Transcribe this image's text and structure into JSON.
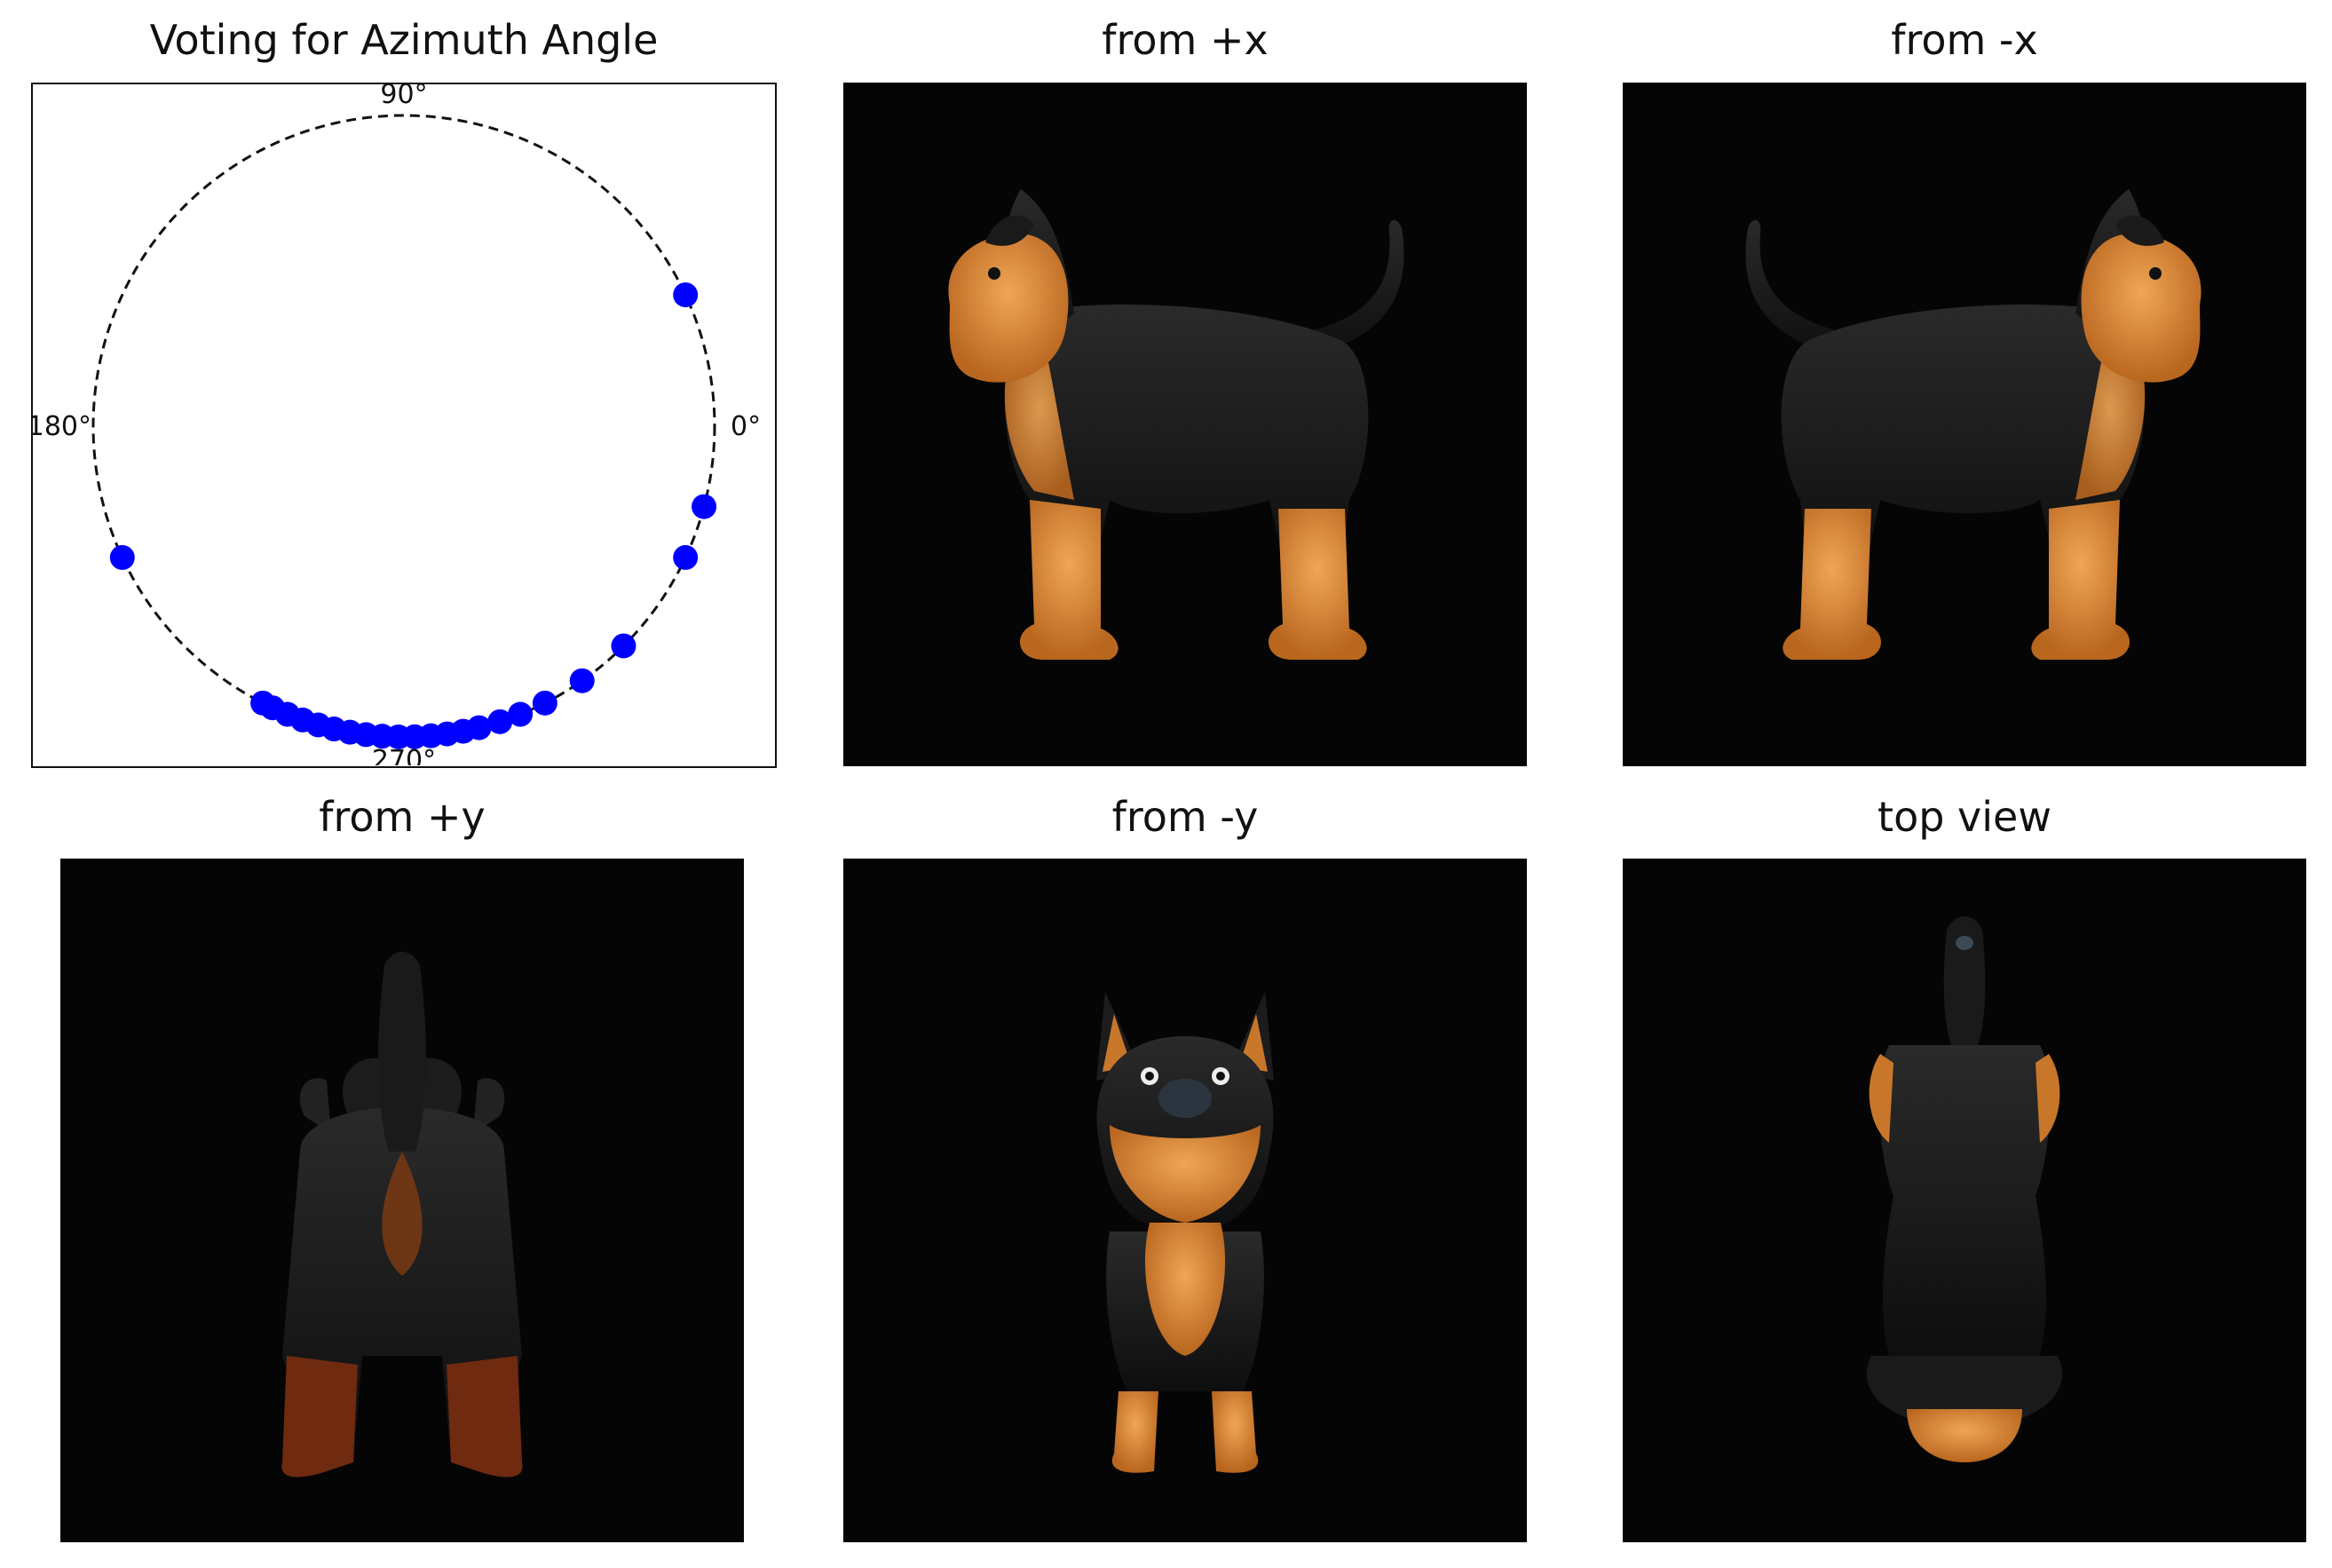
{
  "figure": {
    "panels": [
      {
        "title": "Voting for Azimuth Angle"
      },
      {
        "title": "from +x",
        "view": "dog-side-facing-left"
      },
      {
        "title": "from -x",
        "view": "dog-side-facing-right"
      },
      {
        "title": "from +y",
        "view": "dog-rear"
      },
      {
        "title": "from -y",
        "view": "dog-front"
      },
      {
        "title": "top view",
        "view": "dog-top"
      }
    ]
  },
  "chart_data": {
    "type": "scatter",
    "subtype": "polar",
    "title": "Voting for Azimuth Angle",
    "angle_labels": [
      {
        "label": "0°",
        "angle": 0
      },
      {
        "label": "90°",
        "angle": 90
      },
      {
        "label": "180°",
        "angle": 180
      },
      {
        "label": "270°",
        "angle": 270
      }
    ],
    "reference_circle": "dashed",
    "marker_color": "#0000ff",
    "series": [
      {
        "angles_deg": [
          25,
          345,
          335,
          315,
          305,
          297,
          292,
          288,
          284,
          281,
          278,
          275,
          272,
          269,
          266,
          263,
          260,
          257,
          254,
          251,
          248,
          245,
          243,
          205
        ]
      }
    ]
  },
  "colors": {
    "image_background": "#050505",
    "dog_black": "#141414",
    "dog_tan": "#c8772a",
    "dog_tan_light": "#e29a45"
  }
}
